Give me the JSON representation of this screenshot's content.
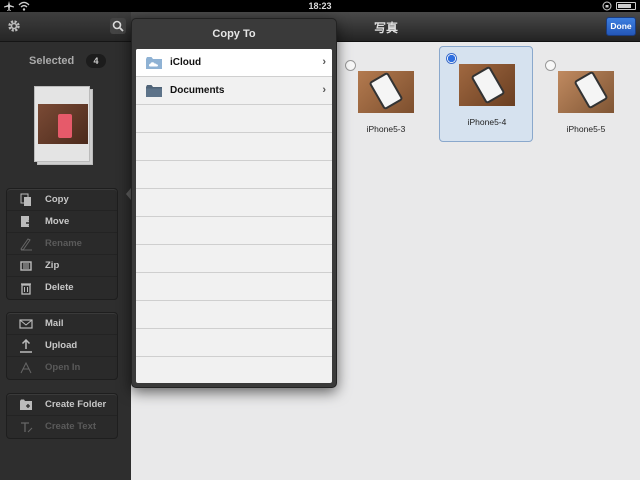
{
  "status": {
    "time": "18:23",
    "icons": [
      "airplane-icon",
      "wifi-icon",
      "orientation-lock-icon",
      "battery-icon"
    ],
    "battery_level": 0.8
  },
  "sidebar": {
    "icons": [
      "gear-icon",
      "search-icon"
    ],
    "selected_label": "Selected",
    "selected_count": "4",
    "groups": [
      [
        {
          "label": "Copy",
          "icon": "copy-icon",
          "enabled": true
        },
        {
          "label": "Move",
          "icon": "move-icon",
          "enabled": true
        },
        {
          "label": "Rename",
          "icon": "rename-icon",
          "enabled": false
        },
        {
          "label": "Zip",
          "icon": "zip-icon",
          "enabled": true
        },
        {
          "label": "Delete",
          "icon": "trash-icon",
          "enabled": true
        }
      ],
      [
        {
          "label": "Mail",
          "icon": "mail-icon",
          "enabled": true
        },
        {
          "label": "Upload",
          "icon": "upload-icon",
          "enabled": true
        },
        {
          "label": "Open In",
          "icon": "open-in-icon",
          "enabled": false
        }
      ],
      [
        {
          "label": "Create Folder",
          "icon": "create-folder-icon",
          "enabled": true
        },
        {
          "label": "Create Text",
          "icon": "create-text-icon",
          "enabled": false
        }
      ]
    ]
  },
  "navbar": {
    "title": "写真",
    "done_label": "Done"
  },
  "photos": [
    {
      "name": "iPhone5-3",
      "selected": false
    },
    {
      "name": "iPhone5-4",
      "selected": true
    },
    {
      "name": "iPhone5-5",
      "selected": false
    }
  ],
  "popover": {
    "title": "Copy To",
    "items": [
      {
        "label": "iCloud",
        "icon": "icloud-folder-icon"
      },
      {
        "label": "Documents",
        "icon": "folder-icon"
      }
    ]
  },
  "colors": {
    "accent": "#2f6fe0",
    "sidebar_bg": "#2e2e2e",
    "content_bg": "#e9e9ea"
  }
}
